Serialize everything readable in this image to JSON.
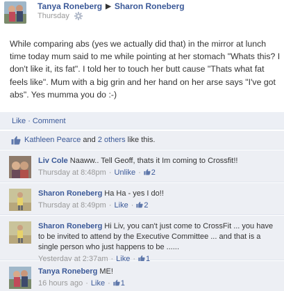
{
  "post": {
    "author": "Tanya Roneberg",
    "target": "Sharon Roneberg",
    "timestamp": "Thursday",
    "text": "While comparing abs (yes we actually did that) in the mirror at lunch time today mum said to me while pointing at her stomach \"Whats this? I don't like it, its fat\". I told her to touch her butt cause \"Thats what fat feels like\". Mum with a big grin and her hand on her arse says \"I've got abs\". Yes mumma you do :-)"
  },
  "actions": {
    "like": "Like",
    "separator": "·",
    "comment": "Comment"
  },
  "likes": {
    "name": "Kathleen Pearce",
    "and": "and",
    "others": "2 others",
    "suffix": "like this."
  },
  "comments": [
    {
      "author": "Liv Cole",
      "text": "Naaww.. Tell Geoff, thats it Im coming to Crossfit!!",
      "time": "Thursday at 8:48pm",
      "action": "Unlike",
      "likes": "2"
    },
    {
      "author": "Sharon Roneberg",
      "text": "Ha Ha - yes I do!!",
      "time": "Thursday at 8:49pm",
      "action": "Like",
      "likes": "2"
    },
    {
      "author": "Sharon Roneberg",
      "text": "Hi Liv, you can't just come to CrossFit ... you have to be invited to attend by the Executive Committee ... and that is a single person who just happens to be ......",
      "time": "Yesterday at 2:37am",
      "action": "Like",
      "likes": "1"
    },
    {
      "author": "Tanya Roneberg",
      "text": "ME!",
      "time": "16 hours ago",
      "action": "Like",
      "likes": "1"
    }
  ],
  "colors": {
    "link": "#3b5998",
    "bar": "#edeff4",
    "muted": "#999999"
  },
  "icons": {
    "gear": "gear-icon",
    "thumb": "thumbs-up-icon",
    "arrow": "triangle-right-icon"
  }
}
